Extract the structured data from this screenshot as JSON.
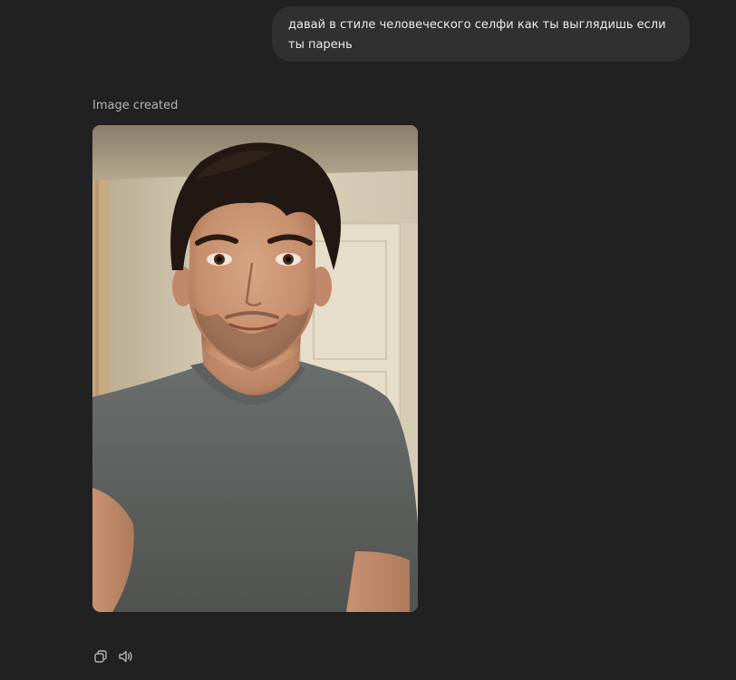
{
  "conversation": {
    "user_message": "давай в стиле человеческого селфи как ты выглядишь если ты парень",
    "assistant_status": "Image created",
    "image": {
      "icon": "generated-photo-selfie"
    },
    "actions": [
      {
        "icon": "copy-icon"
      },
      {
        "icon": "speaker-icon"
      }
    ]
  },
  "colors": {
    "background": "#212121",
    "user_bubble": "#303030",
    "text_primary": "#ececec",
    "text_secondary": "#b4b4b4"
  }
}
